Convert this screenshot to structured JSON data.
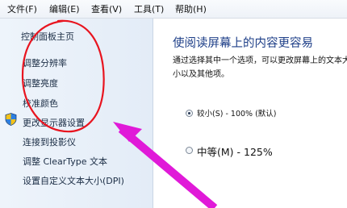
{
  "menubar": {
    "items": [
      "文件(F)",
      "编辑(E)",
      "查看(V)",
      "工具(T)",
      "帮助(H)"
    ]
  },
  "sidebar": {
    "links": [
      "控制面板主页",
      "调整分辨率",
      "调整亮度",
      "校准颜色",
      "更改显示器设置",
      "连接到投影仪",
      "调整 ClearType 文本",
      "设置自定义文本大小(DPI)"
    ]
  },
  "main": {
    "heading": "使阅读屏幕上的内容更容易",
    "description": "通过选择其中一个选项，可以更改屏幕上的文本大小以及其他项。",
    "options": [
      {
        "label": "较小(S) - 100% (默认)",
        "checked": true
      },
      {
        "label": "中等(M) - 125%",
        "checked": false
      }
    ]
  },
  "annotations": {
    "circle_color": "#e8141f",
    "arrow_color": "#e01ad8"
  }
}
